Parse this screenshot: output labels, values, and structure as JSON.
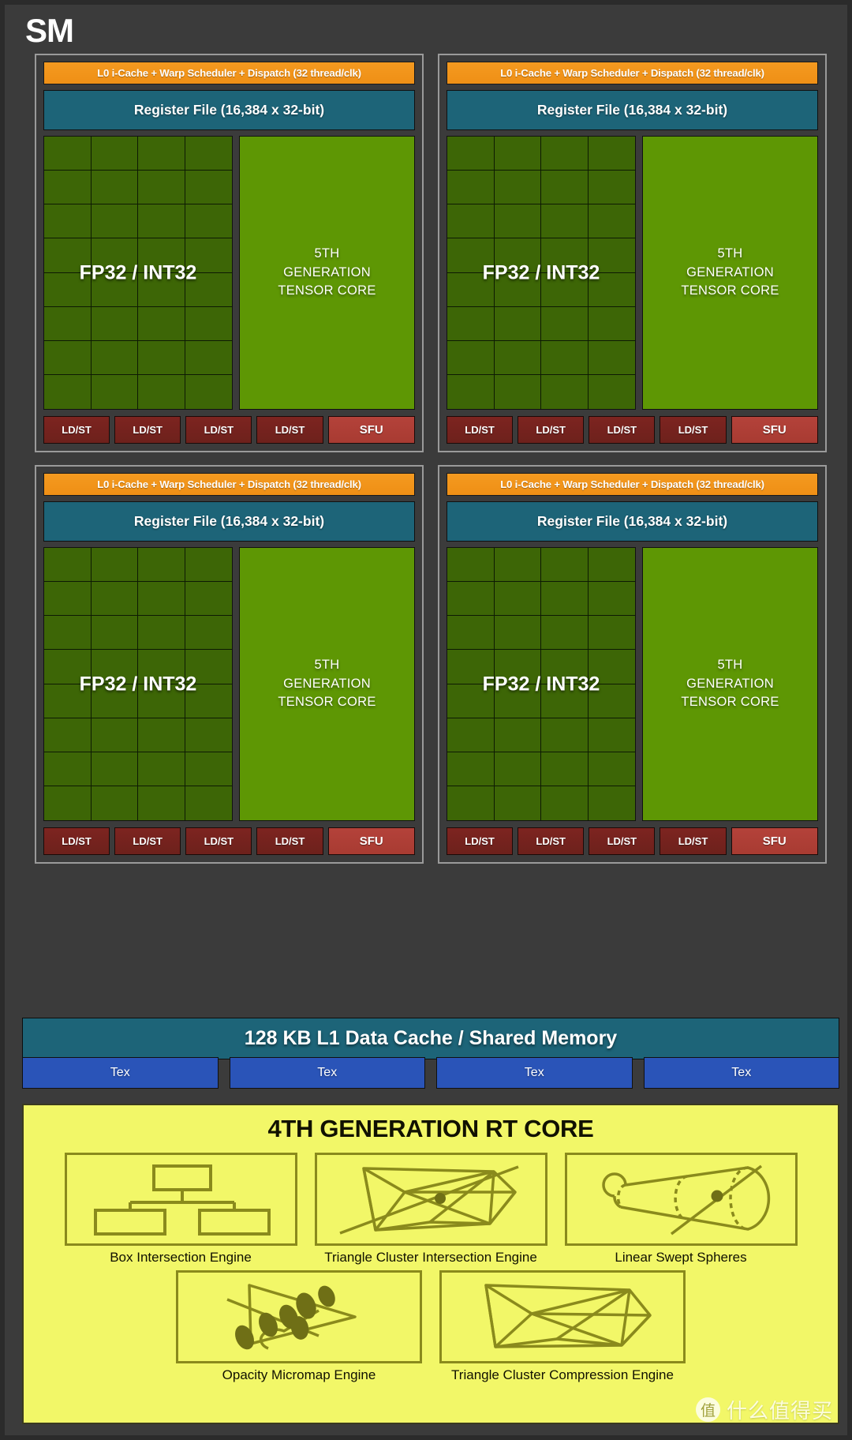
{
  "title": "SM",
  "colors": {
    "background": "#3b3b3b",
    "scheduler_orange": "#f49a20",
    "register_teal": "#1d6478",
    "fp32_green": "#3d6606",
    "tensor_green": "#5e9704",
    "ldst_red": "#7d2420",
    "sfu_red": "#b4423a",
    "tex_blue": "#2a54b8",
    "rt_yellow": "#f2f768",
    "rt_outline": "#8a8a1c"
  },
  "processing_blocks": [
    {
      "scheduler": "L0 i-Cache + Warp Scheduler + Dispatch (32 thread/clk)",
      "register_file": "Register File (16,384 x 32-bit)",
      "fp_label": "FP32 / INT32",
      "fp_grid": {
        "columns": 4,
        "rows": 8
      },
      "tensor_core": "5TH\nGENERATION\nTENSOR CORE",
      "tensor_core_lines": [
        "5TH",
        "GENERATION",
        "TENSOR CORE"
      ],
      "ldst": [
        "LD/ST",
        "LD/ST",
        "LD/ST",
        "LD/ST"
      ],
      "sfu": "SFU"
    },
    {
      "scheduler": "L0 i-Cache + Warp Scheduler + Dispatch (32 thread/clk)",
      "register_file": "Register File (16,384 x 32-bit)",
      "fp_label": "FP32 / INT32",
      "fp_grid": {
        "columns": 4,
        "rows": 8
      },
      "tensor_core_lines": [
        "5TH",
        "GENERATION",
        "TENSOR CORE"
      ],
      "ldst": [
        "LD/ST",
        "LD/ST",
        "LD/ST",
        "LD/ST"
      ],
      "sfu": "SFU"
    },
    {
      "scheduler": "L0 i-Cache + Warp Scheduler + Dispatch (32 thread/clk)",
      "register_file": "Register File (16,384 x 32-bit)",
      "fp_label": "FP32 / INT32",
      "fp_grid": {
        "columns": 4,
        "rows": 8
      },
      "tensor_core_lines": [
        "5TH",
        "GENERATION",
        "TENSOR CORE"
      ],
      "ldst": [
        "LD/ST",
        "LD/ST",
        "LD/ST",
        "LD/ST"
      ],
      "sfu": "SFU"
    },
    {
      "scheduler": "L0 i-Cache + Warp Scheduler + Dispatch (32 thread/clk)",
      "register_file": "Register File (16,384 x 32-bit)",
      "fp_label": "FP32 / INT32",
      "fp_grid": {
        "columns": 4,
        "rows": 8
      },
      "tensor_core_lines": [
        "5TH",
        "GENERATION",
        "TENSOR CORE"
      ],
      "ldst": [
        "LD/ST",
        "LD/ST",
        "LD/ST",
        "LD/ST"
      ],
      "sfu": "SFU"
    }
  ],
  "l1_cache": "128 KB L1 Data Cache / Shared Memory",
  "tex_units": [
    "Tex",
    "Tex",
    "Tex",
    "Tex"
  ],
  "rt_core": {
    "title": "4TH GENERATION RT CORE",
    "engines_row1": [
      {
        "label": "Box Intersection Engine",
        "icon": "hierarchy-boxes-icon"
      },
      {
        "label": "Triangle Cluster Intersection Engine",
        "icon": "triangle-mesh-ray-icon"
      },
      {
        "label": "Linear Swept Spheres",
        "icon": "swept-sphere-cone-icon"
      }
    ],
    "engines_row2": [
      {
        "label": "Opacity Micromap Engine",
        "icon": "leaf-triangle-icon"
      },
      {
        "label": "Triangle Cluster Compression Engine",
        "icon": "triangle-mesh-icon"
      }
    ]
  },
  "watermark": {
    "logo": "值",
    "text": "什么值得买"
  }
}
